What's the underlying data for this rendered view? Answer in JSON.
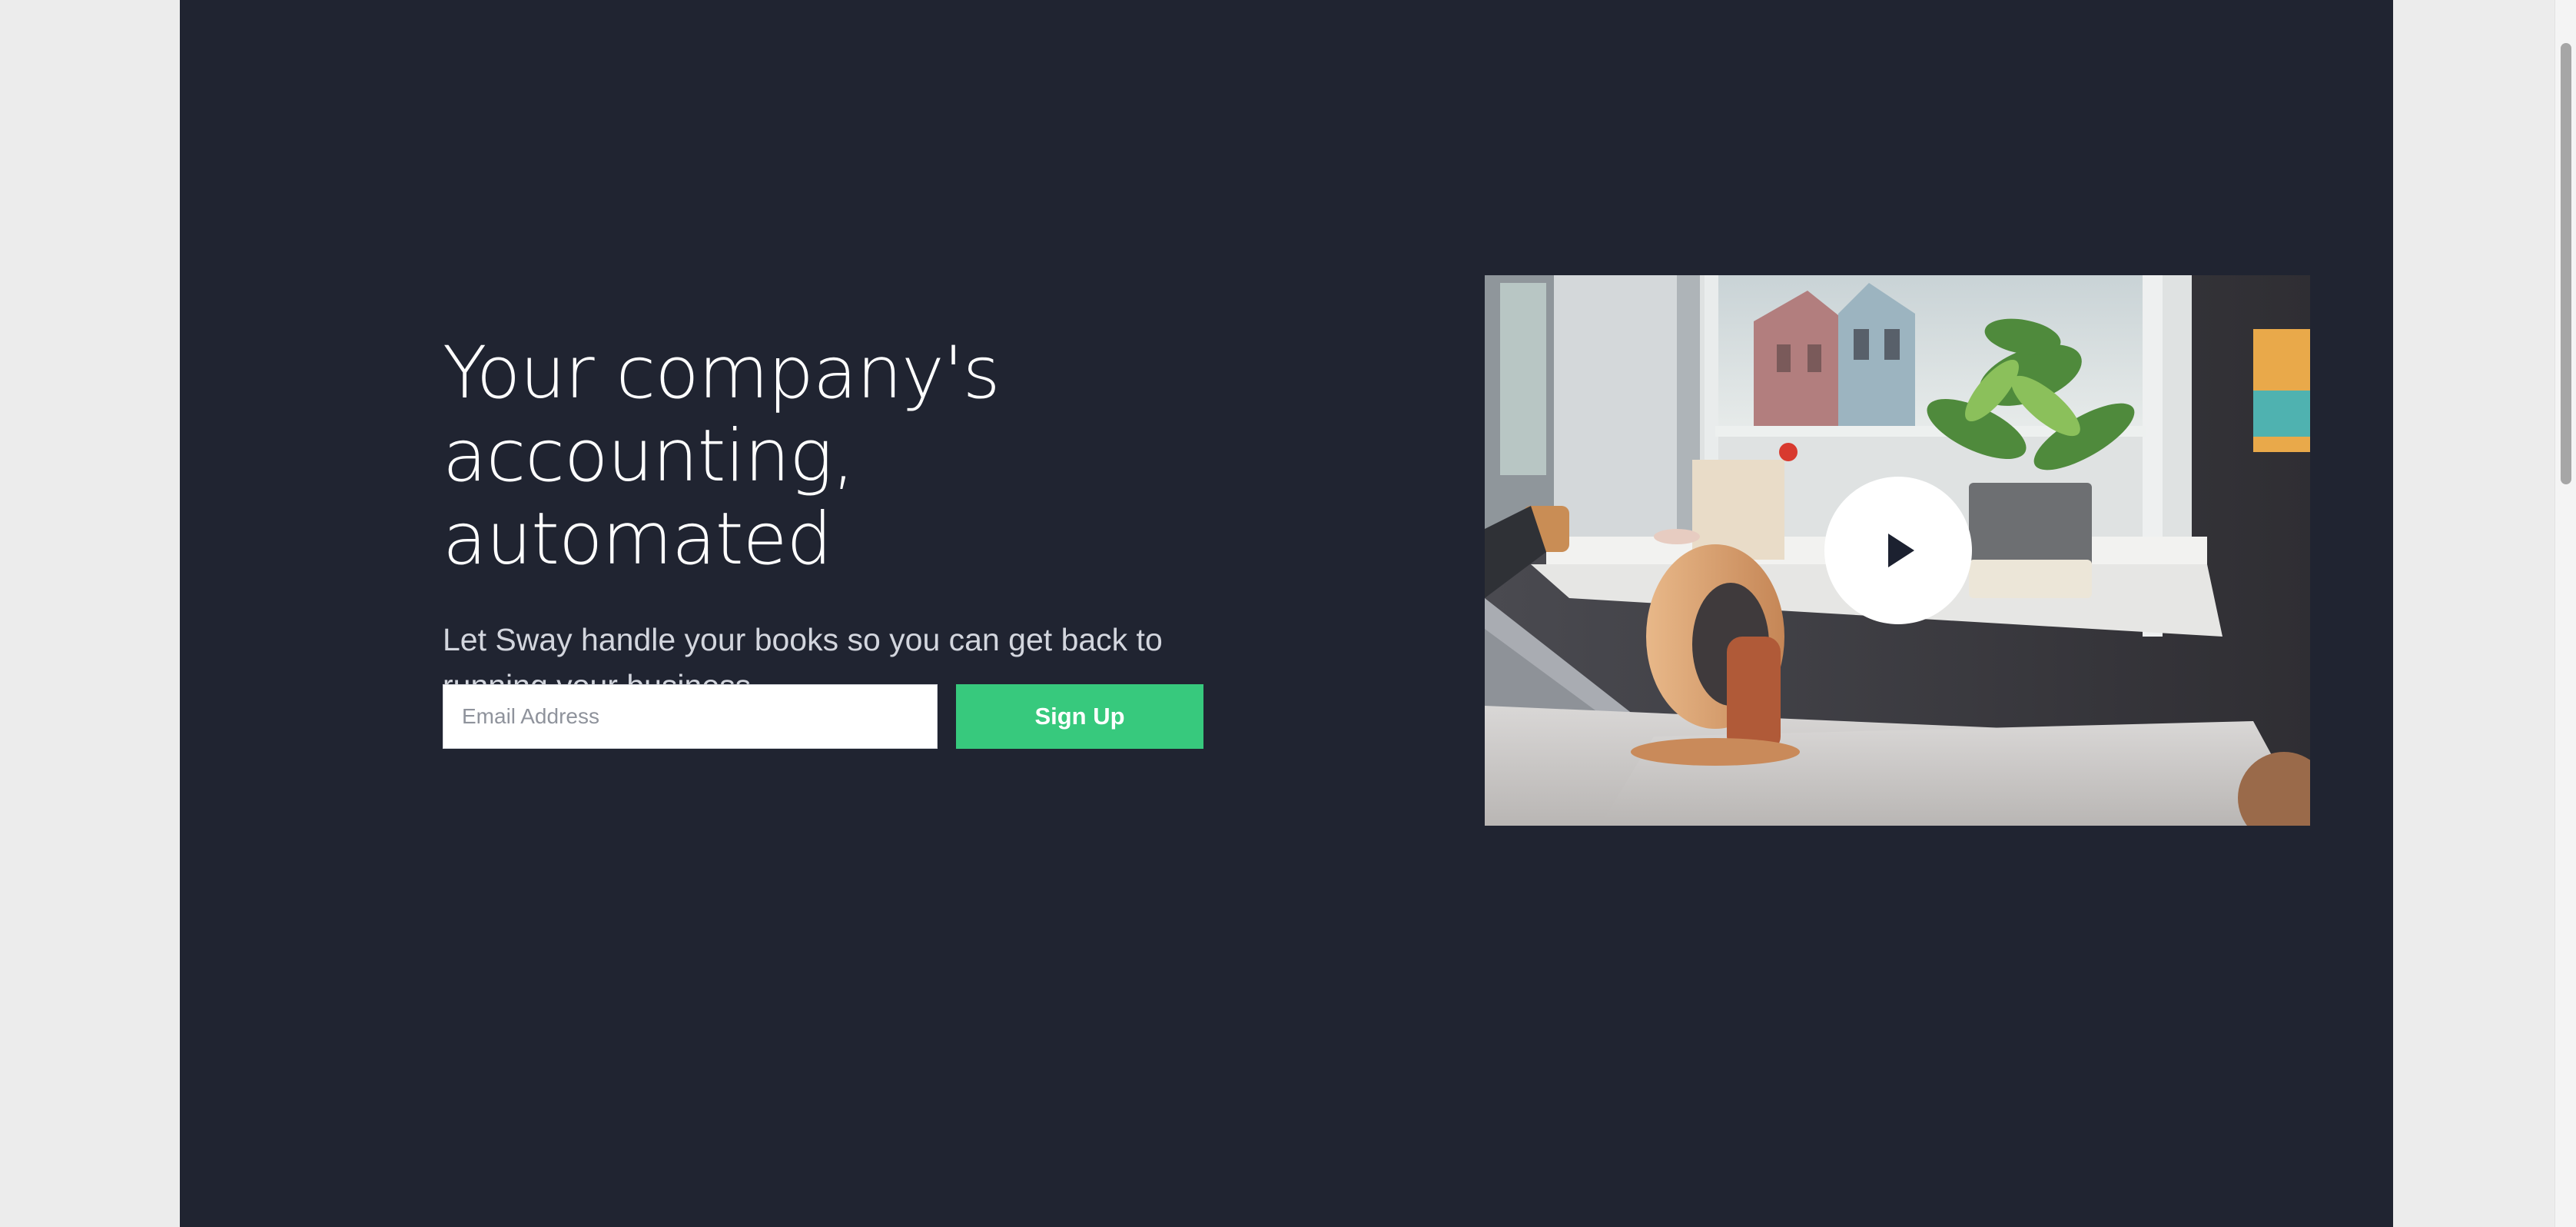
{
  "hero": {
    "headline_line1": "Your company's",
    "headline_line2": "accounting, automated",
    "subheadline": "Let Sway handle your books so you can get back to running your business.",
    "email_placeholder": "Email Address",
    "signup_label": "Sign Up"
  },
  "video": {
    "play_icon": "play-icon"
  },
  "colors": {
    "background": "#202431",
    "accent": "#37c97d",
    "page": "#ececec"
  }
}
